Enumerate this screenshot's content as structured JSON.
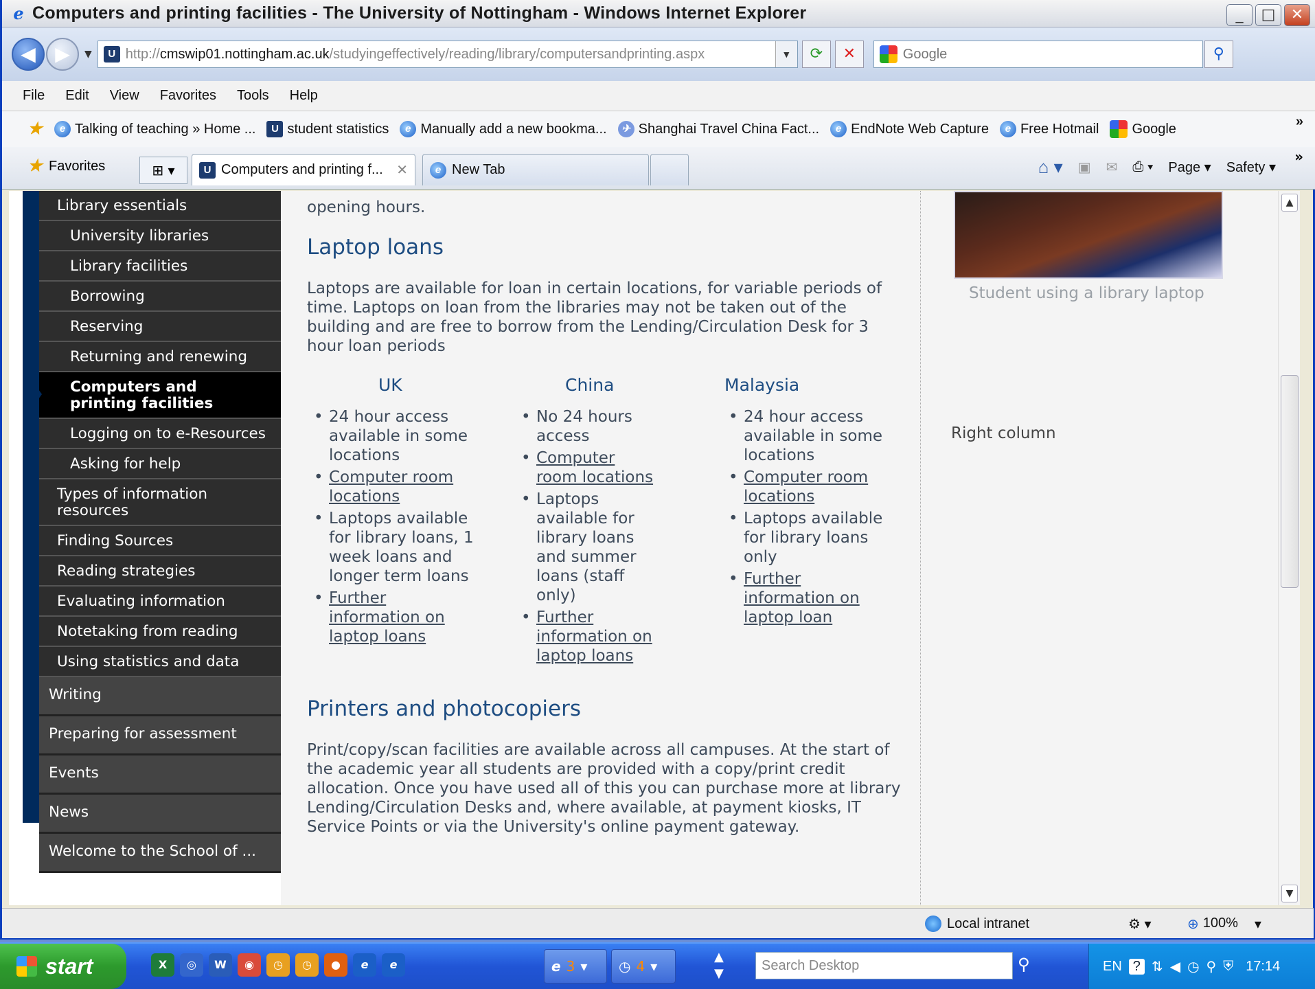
{
  "window": {
    "title": "Computers and printing facilities - The University of Nottingham - Windows Internet Explorer",
    "minimize": "_",
    "maximize": "□",
    "close": "✕"
  },
  "address": {
    "prefix": "http://",
    "host": "cmswip01.nottingham.ac.uk",
    "path": "/studyingeffectively/reading/library/computersandprinting.aspx",
    "search_placeholder": "Google"
  },
  "menu": [
    "File",
    "Edit",
    "View",
    "Favorites",
    "Tools",
    "Help"
  ],
  "bookmarks": [
    {
      "label": "Talking of teaching » Home ...",
      "icon": "ie-icon"
    },
    {
      "label": "student statistics",
      "icon": "uni-icon"
    },
    {
      "label": "Manually add a new bookma...",
      "icon": "ie-icon"
    },
    {
      "label": "Shanghai Travel China Fact...",
      "icon": "travel-icon"
    },
    {
      "label": "EndNote Web Capture",
      "icon": "ie-icon"
    },
    {
      "label": "Free Hotmail",
      "icon": "ie-icon"
    },
    {
      "label": "Google",
      "icon": "google-icon"
    }
  ],
  "tabs": {
    "favorites": "Favorites",
    "active": "Computers and printing f...",
    "newtab": "New Tab"
  },
  "commands": {
    "page": "Page",
    "safety": "Safety"
  },
  "sidebar": {
    "items": [
      {
        "label": "Library essentials",
        "level": "section"
      },
      {
        "label": "University libraries",
        "level": "sub"
      },
      {
        "label": "Library facilities",
        "level": "sub"
      },
      {
        "label": "Borrowing",
        "level": "sub"
      },
      {
        "label": "Reserving",
        "level": "sub"
      },
      {
        "label": "Returning and renewing",
        "level": "sub"
      },
      {
        "label": "Computers and printing facilities",
        "level": "active"
      },
      {
        "label": "Logging on to e-Resources",
        "level": "sub"
      },
      {
        "label": "Asking for help",
        "level": "sub"
      },
      {
        "label": "Types of information resources",
        "level": "section"
      },
      {
        "label": "Finding Sources",
        "level": "section"
      },
      {
        "label": "Reading strategies",
        "level": "section"
      },
      {
        "label": "Evaluating information",
        "level": "section"
      },
      {
        "label": "Notetaking from reading",
        "level": "section"
      },
      {
        "label": "Using statistics and data",
        "level": "section"
      }
    ],
    "top": [
      "Writing",
      "Preparing for assessment",
      "Events",
      "News",
      "Welcome to the School of ..."
    ]
  },
  "main": {
    "intro_tail": "opening hours.",
    "laptop_heading": "Laptop loans",
    "laptop_text": "Laptops are available for loan in certain locations, for variable periods of time. Laptops on loan from the libraries may not be taken out of the building and are free to borrow from the Lending/Circulation Desk for 3 hour loan periods",
    "columns": [
      {
        "title": "UK",
        "items": [
          {
            "text": "24 hour access available in some locations",
            "link": false
          },
          {
            "text": "Computer room locations",
            "link": true
          },
          {
            "text": "Laptops available for library loans, 1 week loans and longer term loans",
            "link": false
          },
          {
            "text": "Further information on laptop loans",
            "link": true
          }
        ]
      },
      {
        "title": "China",
        "items": [
          {
            "text": "No 24 hours access",
            "link": false
          },
          {
            "text": "Computer room locations",
            "link": true
          },
          {
            "text": "Laptops available for library loans and summer loans (staff only)",
            "link": false
          },
          {
            "text": "Further information on laptop loans",
            "link": true
          }
        ]
      },
      {
        "title": "Malaysia",
        "items": [
          {
            "text": "24 hour access available in some locations",
            "link": false
          },
          {
            "text": "Computer room locations",
            "link": true
          },
          {
            "text": "Laptops available for library loans only",
            "link": false
          },
          {
            "text": "Further information on laptop loan",
            "link": true
          }
        ]
      }
    ],
    "printers_heading": "Printers and photocopiers",
    "printers_text": "Print/copy/scan facilities are available across all campuses. At the start of the academic year all students are provided with a copy/print credit allocation. Once you have used all of this you can purchase more at library Lending/Circulation Desks and, where available, at payment kiosks, IT Service Points or via the University's online payment gateway."
  },
  "right": {
    "caption": "Student using a library laptop",
    "label": "Right column"
  },
  "status": {
    "zone": "Local intranet",
    "zoom": "100%"
  },
  "taskbar": {
    "start": "start",
    "ie_count": "3",
    "group_count": "4",
    "search_placeholder": "Search Desktop",
    "lang": "EN",
    "clock": "17:14"
  }
}
